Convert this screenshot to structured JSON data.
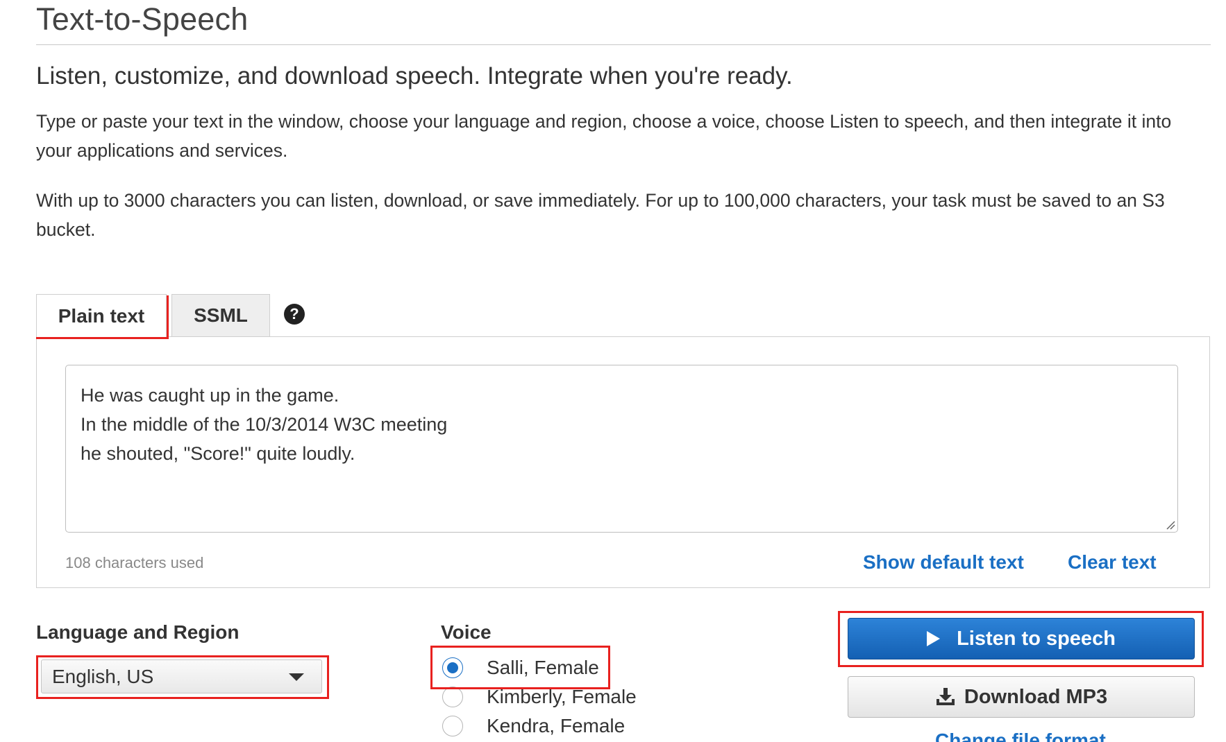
{
  "header": {
    "title": "Text-to-Speech",
    "subtitle": "Listen, customize, and download speech. Integrate when you're ready.",
    "description_1": "Type or paste your text in the window, choose your language and region, choose a voice, choose Listen to speech, and then integrate it into your applications and services.",
    "description_2": "With up to 3000 characters you can listen, download, or save immediately. For up to 100,000 characters, your task must be saved to an S3 bucket."
  },
  "tabs": [
    {
      "label": "Plain text",
      "active": true
    },
    {
      "label": "SSML",
      "active": false
    }
  ],
  "help_icon": "question-circle-icon",
  "editor": {
    "text": "He was caught up in the game.\nIn the middle of the 10/3/2014 W3C meeting\nhe shouted, \"Score!\" quite loudly.",
    "char_count": "108 characters used",
    "show_default_label": "Show default text",
    "clear_label": "Clear text"
  },
  "language": {
    "label": "Language and Region",
    "selected": "English, US"
  },
  "voice": {
    "label": "Voice",
    "options": [
      {
        "label": "Salli, Female",
        "selected": true
      },
      {
        "label": "Kimberly, Female",
        "selected": false
      },
      {
        "label": "Kendra, Female",
        "selected": false
      }
    ]
  },
  "actions": {
    "listen_label": "Listen to speech",
    "download_label": "Download MP3",
    "change_format_label": "Change file format"
  },
  "colors": {
    "accent": "#1a6fc4",
    "primary_button": "#1f72c8",
    "highlight": "#e8211f"
  }
}
